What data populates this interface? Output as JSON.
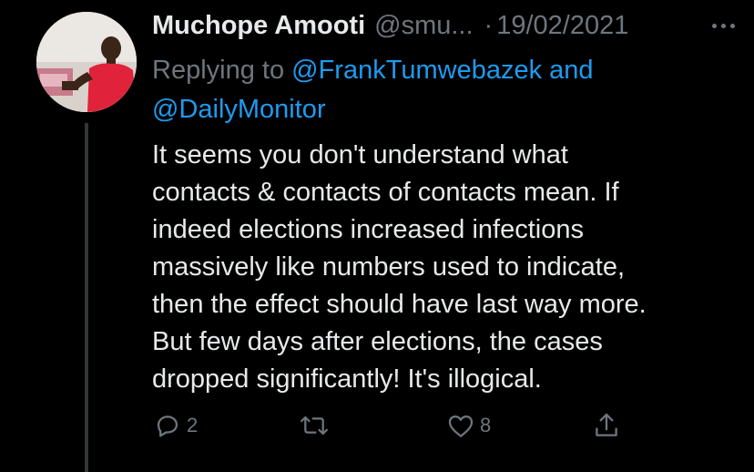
{
  "tweet": {
    "author_name": "Muchope Amooti",
    "handle": "@smu...",
    "separator": "·",
    "date": "19/02/2021",
    "replying_prefix": "Replying to",
    "mention_1": "@FrankTumwebazek",
    "conjunction": "and",
    "mention_2": "@DailyMonitor",
    "body_lines": [
      "It seems you don't understand what",
      "contacts & contacts of contacts mean. If",
      "indeed elections increased infections",
      "massively like numbers used to indicate,",
      "then the effect should have last way more.",
      "But few days after elections, the cases",
      "dropped significantly! It's illogical."
    ]
  },
  "actions": {
    "reply_count": "2",
    "retweet_count": "",
    "like_count": "8"
  },
  "icons": {
    "more": "more-horizontal-icon",
    "reply": "reply-icon",
    "retweet": "retweet-icon",
    "like": "heart-icon",
    "share": "share-icon"
  },
  "colors": {
    "background": "#000000",
    "text": "#e7e9ea",
    "secondary": "#6e767d",
    "link": "#1d9bf0",
    "thread_line": "#333639"
  }
}
